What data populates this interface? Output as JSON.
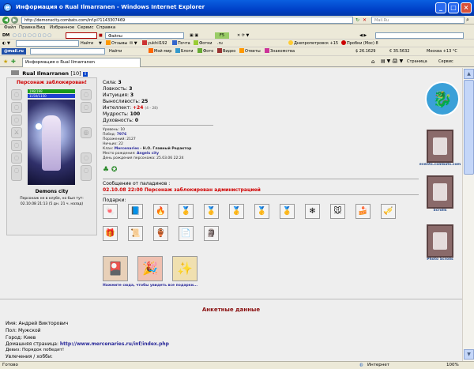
{
  "window": {
    "title": "Информация о Rual Ilmarranen - Windows Internet Explorer",
    "minimize": "_",
    "maximize": "□",
    "close": "×"
  },
  "address": {
    "url": "http://demonscity.combats.com/inf.pl?1143307469",
    "search_placeholder": "Mail.Ru"
  },
  "menu": [
    "Файл",
    "Правка",
    "Вид",
    "Избранное",
    "Сервис",
    "Справка"
  ],
  "toolbar1": {
    "dm": "DM",
    "find": "Найти",
    "files": "Файлы",
    "reviews": "Отзывы",
    "mail": "Почта",
    "photos": "Фотки",
    "user": "yukhil192",
    "ru": ".ru",
    "weather": "Днепропетровск +15",
    "traffic": "Пробки (Мос) 8"
  },
  "toolbar2": {
    "logo": "@mail.ru",
    "find": "Найти",
    "mymir": "Мой мир",
    "blogs": "Блоги",
    "photo": "Фото",
    "video": "Видео",
    "answers": "Ответы",
    "dating": "Знакомства",
    "usd": "$ 26.1629",
    "eur": "€ 35.5632",
    "moscow": "Москва +13 °C"
  },
  "tab": {
    "label": "Информация о Rual Ilmarranen",
    "home": "⌂",
    "page": "Страница",
    "service": "Сервис"
  },
  "character": {
    "name": "Rual Ilmarranen",
    "level": "[10]",
    "blocked": "Персонаж заблокирован!",
    "hp": "198/198",
    "mana": "1150/1150",
    "city": "Demons city",
    "last_seen": "Персонаж не в клубе, но был тут:",
    "last_seen_date": "02.10.08 21:13 (5 дн. 21 ч. назад)"
  },
  "stats": [
    {
      "label": "Сила:",
      "value": "3"
    },
    {
      "label": "Ловкость:",
      "value": "3"
    },
    {
      "label": "Интуиция:",
      "value": "3"
    },
    {
      "label": "Выносливость:",
      "value": "25"
    },
    {
      "label": "Интеллект:",
      "value": "+24",
      "extra": "(4 - 28)"
    },
    {
      "label": "Мудрость:",
      "value": "100"
    },
    {
      "label": "Духовность:",
      "value": "0"
    }
  ],
  "info": {
    "level": "Уровень: 10",
    "wins_label": "Побед:",
    "wins": "7976",
    "losses": "Поражений: 2127",
    "draws": "Ничьих: 22",
    "clan_label": "Клан:",
    "clan": "Mercenaries",
    "clan_role": "- Н.О. Главный Редактор",
    "birthplace_label": "Место рождения:",
    "birthplace": "Angels city",
    "birthday": "День рождения персонажа: 25.03.06 22:24"
  },
  "paladin": {
    "header": "Сообщение от паладинов :",
    "message": "02.10.08 22:00 Персонаж заблокирован администрацией"
  },
  "gifts": {
    "header": "Подарки:",
    "row1": [
      "🍬",
      "📘",
      "🔥",
      "🥇",
      "🥇",
      "🥇",
      "🥇",
      "🥇",
      "❄",
      "🐭",
      "🍰",
      "🎺"
    ],
    "row2": [
      "🎁",
      "📜",
      "🏺",
      "📄",
      "🗿"
    ],
    "cards": [
      "🎴",
      "🎉",
      "✨"
    ],
    "more": "Нажмите сюда, чтобы увидеть все подарки..."
  },
  "sidebar": [
    {
      "label": "events.combats.com",
      "icon": "dragon-icon"
    },
    {
      "label": "Scrolls",
      "icon": "scroll-icon"
    },
    {
      "label": "Photo Scrolls",
      "icon": "photo-scroll-icon"
    }
  ],
  "profile": {
    "title": "Анкетные данные",
    "name": "Имя: Андрей Викторович",
    "gender": "Пол: Мужской",
    "city": "Город: Киев",
    "homepage_label": "Домашняя страница:",
    "homepage": "http://www.mercenaries.ru/inf/index.php",
    "motto": "Девиз: Порядок победит!",
    "hobby": "Увлечения / хобби:"
  },
  "status": {
    "left": "Готово",
    "zone": "Интернет",
    "zoom": "100%"
  },
  "colors": {
    "blocked": "#d00000",
    "link": "#2a2a9a",
    "accent": "#0041c8"
  }
}
